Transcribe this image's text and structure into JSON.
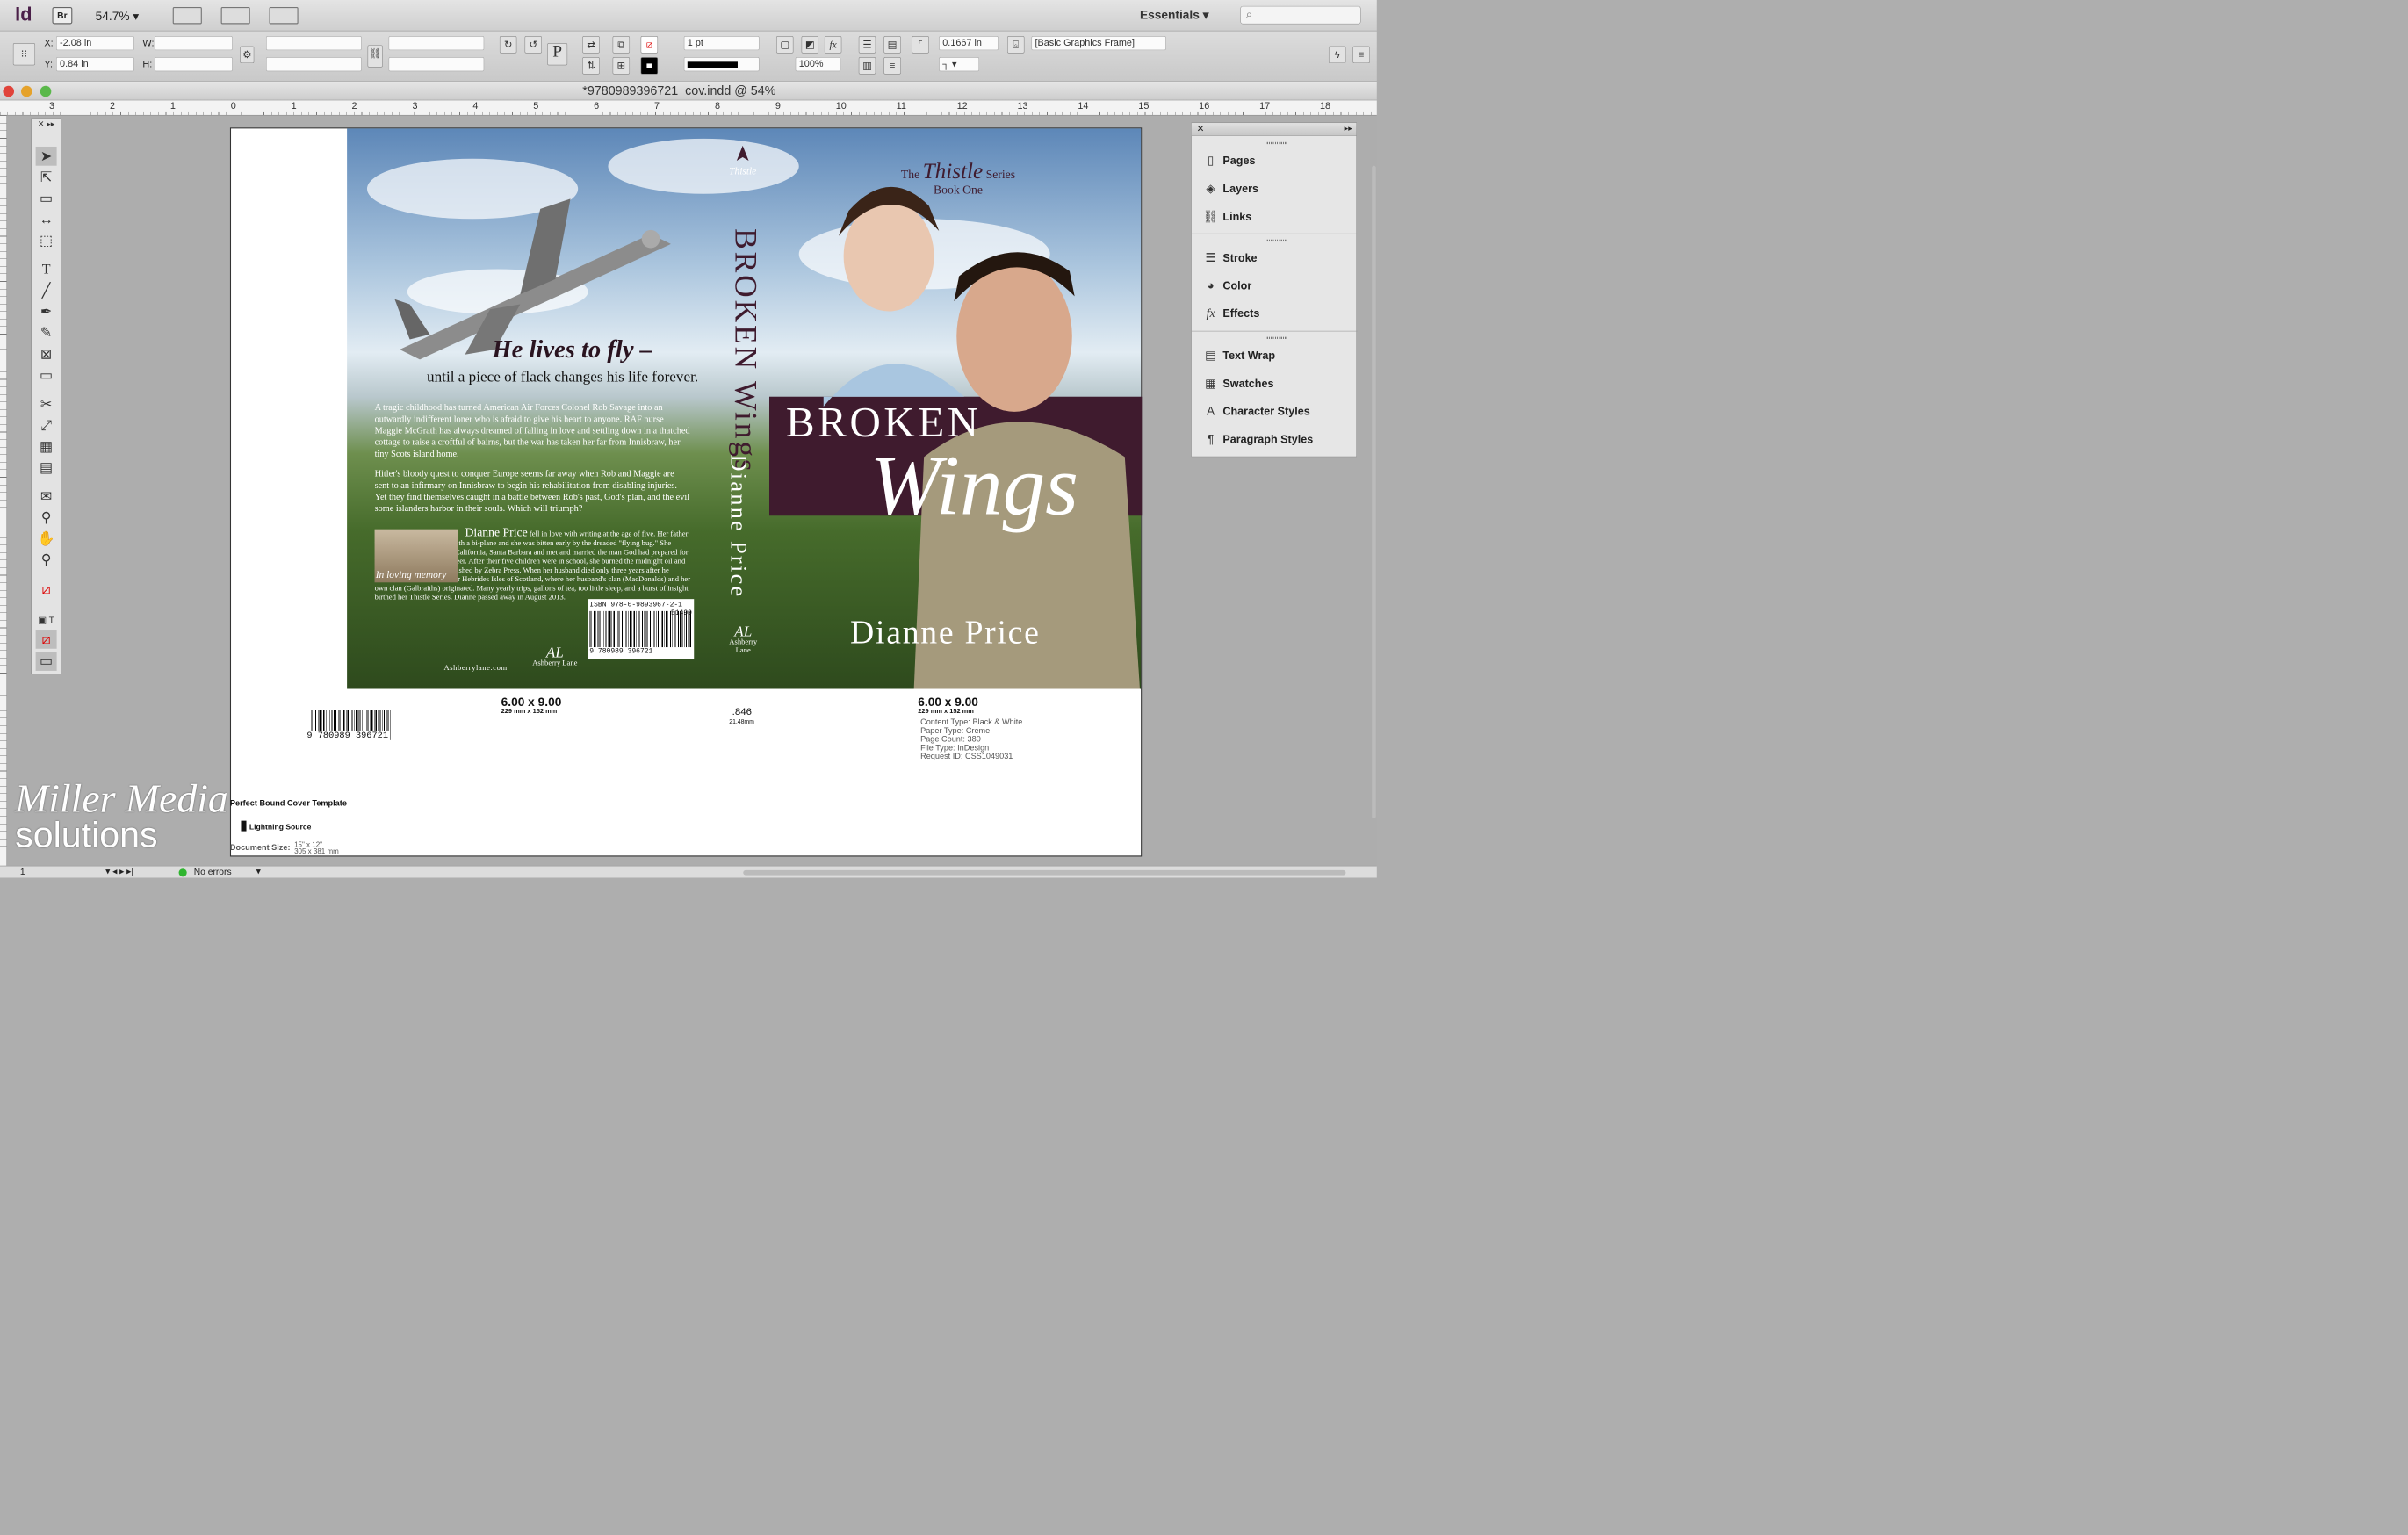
{
  "app": {
    "logo": "Id",
    "bridge": "Br",
    "zoom": "54.7%",
    "workspace": "Essentials",
    "search_placeholder": ""
  },
  "control": {
    "x_label": "X:",
    "x_value": "-2.08 in",
    "y_label": "Y:",
    "y_value": "0.84 in",
    "w_label": "W:",
    "h_label": "H:",
    "stroke_weight": "1 pt",
    "opacity": "100%",
    "offset": "0.1667 in",
    "object_style": "[Basic Graphics Frame]"
  },
  "doc": {
    "title": "*9780989396721_cov.indd @ 54%"
  },
  "ruler": [
    "3",
    "2",
    "1",
    "0",
    "1",
    "2",
    "3",
    "4",
    "5",
    "6",
    "7",
    "8",
    "9",
    "10",
    "11",
    "12",
    "13",
    "14",
    "15",
    "16",
    "17",
    "18"
  ],
  "cover": {
    "series_the": "The",
    "series_name": "Thistle",
    "series_word": "Series",
    "series_book": "Book One",
    "title_top": "BROKEN",
    "title_bottom": "Wings",
    "author": "Dianne Price",
    "spine_title": "BROKEN Wings",
    "spine_author": "Dianne Price",
    "tagline": "He lives to fly –",
    "subtag": "until a piece of flack changes his life forever.",
    "blurb1": "A tragic childhood has turned American Air Forces Colonel Rob Savage into an outwardly indifferent loner who is afraid to give his heart to anyone. RAF nurse Maggie McGrath has always dreamed of falling in love and settling down in a thatched cottage to raise a croftful of bairns, but the war has taken her far from Innisbraw, her tiny Scots island home.",
    "blurb2": "Hitler's bloody quest to conquer Europe seems far away when Rob and Maggie are sent to an infirmary on Innisbraw to begin his rehabilitation from disabling injuries. Yet they find themselves caught in a battle between Rob's past, God's plan, and the evil some islanders harbor in their souls. Which will triumph?",
    "memory": "In loving memory",
    "bio_name": "Dianne Price",
    "bio": "fell in love with writing at the age of five. Her father was a barnstorming pilot with a bi-plane and she was bitten early by the dreaded \"flying bug.\" She attended the University of California, Santa Barbara and met and married the man God had prepared for her—an aeronautical engineer. After their five children were in school, she burned the midnight oil and wrote three novels, all published by Zebra Press. When her husband died only three years after he retired, she visited the Outer Hebrides Isles of Scotland, where her husband's clan (MacDonalds) and her own clan (Galbraiths) originated. Many yearly trips, gallons of tea, too little sleep, and a burst of insight birthed her Thistle Series. Dianne passed away in August 2013.",
    "isbn": "ISBN 978-0-9893967-2-1",
    "isbn_price": "51499",
    "isbn_digits": "9 780989 396721",
    "site": "Ashberrylane.com",
    "publisher": "Ashberry Lane"
  },
  "template": {
    "size_left": "6.00 x 9.00",
    "size_left_mm": "229 mm x 152 mm",
    "size_right": "6.00 x 9.00",
    "size_right_mm": "229 mm x 152 mm",
    "spine": ".846",
    "spine_mm": "21.48mm",
    "specs": [
      "Content Type: Black & White",
      "Paper Type: Creme",
      "Page Count: 380",
      "File Type: InDesign",
      "Request ID: CSS1049031"
    ],
    "barcode_digits": "9 780989 396721",
    "title": "Perfect Bound Cover Template",
    "lightning": "Lightning Source",
    "docsize_label": "Document Size:",
    "docsize": "15\" x 12\"",
    "docsize_mm": "305 x 381 mm"
  },
  "panel": {
    "items": [
      "Pages",
      "Layers",
      "Links",
      "Stroke",
      "Color",
      "Effects",
      "Text Wrap",
      "Swatches",
      "Character Styles",
      "Paragraph Styles"
    ]
  },
  "status": {
    "page": "1",
    "errors": "No errors"
  },
  "watermark": {
    "line1": "Miller Media",
    "line2": "solutions"
  }
}
